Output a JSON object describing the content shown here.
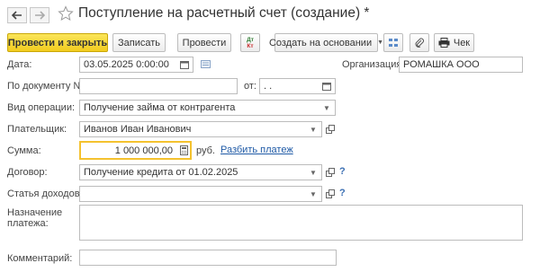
{
  "window": {
    "title": "Поступление на расчетный счет (создание) *"
  },
  "toolbar": {
    "post_and_close": "Провести и закрыть",
    "save": "Записать",
    "post": "Провести",
    "create_based_on": "Создать на основании",
    "receipt": "Чек",
    "dt_kt_top": "Дт",
    "dt_kt_bottom": "Кт"
  },
  "form": {
    "date_label": "Дата:",
    "date_value": "03.05.2025  0:00:00",
    "org_label": "Организация:",
    "org_value": "РОМАШКА ООО",
    "doc_no_label": "По документу №:",
    "doc_no_value": "",
    "from_label": "от:",
    "from_value": " .  .",
    "operation_label": "Вид операции:",
    "operation_value": "Получение займа от контрагента",
    "payer_label": "Плательщик:",
    "payer_value": "Иванов Иван Иванович",
    "amount_label": "Сумма:",
    "amount_value": "1 000 000,00",
    "currency": "руб.",
    "split_link": "Разбить платеж",
    "contract_label": "Договор:",
    "contract_value": "Получение кредита от 01.02.2025",
    "income_item_label": "Статья доходов:",
    "income_item_value": "",
    "purpose_label_1": "Назначение",
    "purpose_label_2": "платежа:",
    "purpose_value": "",
    "comment_label": "Комментарий:",
    "comment_value": "",
    "help_mark": "?"
  },
  "colors": {
    "primary_button": "#f2cc1f",
    "link": "#1f5aa6",
    "focus_border": "#f4c22f",
    "help": "#3b6fb3"
  }
}
